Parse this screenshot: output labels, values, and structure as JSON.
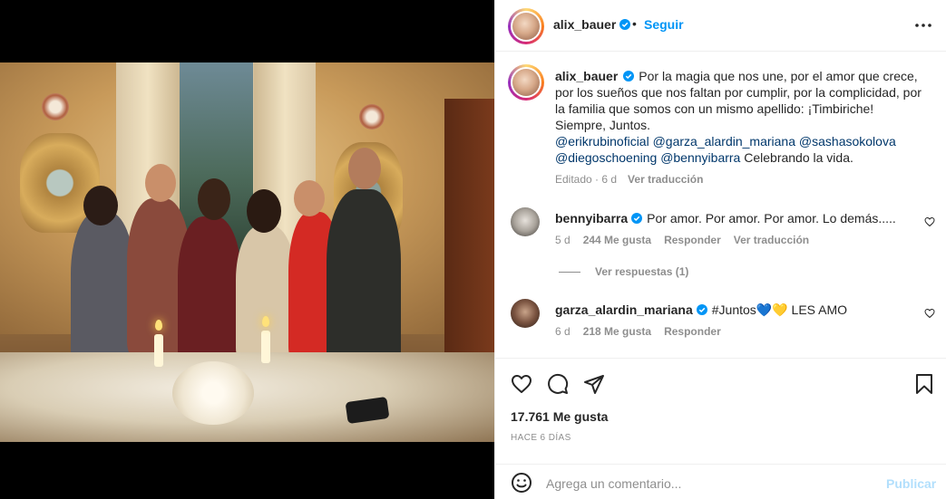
{
  "post": {
    "author": "alix_bauer",
    "follow_label": "Seguir",
    "dot": "•",
    "more_icon": "more-horizontal-icon"
  },
  "caption": {
    "author": "alix_bauer",
    "text": "Por la magia que nos une, por el amor que crece, por los sueños que nos faltan por cumplir, por la complicidad, por la familia que somos con un mismo apellido: ¡Timbiriche! Siempre, Juntos.",
    "tags": [
      "@erikrubinoficial",
      "@garza_alardin_mariana",
      "@sashasokolova",
      "@diegoschoening",
      "@bennyibarra"
    ],
    "tail": "Celebrando la vida.",
    "edited": "Editado · 6 d",
    "translate": "Ver traducción"
  },
  "comments": [
    {
      "author": "bennyibarra",
      "text": "Por amor. Por amor. Por amor. Lo demás.....",
      "time": "5 d",
      "likes": "244 Me gusta",
      "reply": "Responder",
      "translate": "Ver traducción",
      "view_replies": "Ver respuestas (1)"
    },
    {
      "author": "garza_alardin_mariana",
      "text": "#Juntos💙💛 LES AMO",
      "time": "6 d",
      "likes": "218 Me gusta",
      "reply": "Responder"
    }
  ],
  "actions": {
    "like_icon": "heart-icon",
    "comment_icon": "comment-icon",
    "share_icon": "send-icon",
    "save_icon": "bookmark-icon"
  },
  "stats": {
    "likes": "17.761 Me gusta",
    "date": "HACE 6 DÍAS"
  },
  "add_comment": {
    "placeholder": "Agrega un comentario...",
    "publish": "Publicar"
  },
  "colors": {
    "accent": "#0095f6",
    "link": "#00376b",
    "muted": "#8e8e8e",
    "publish_disabled": "#b2dffc"
  }
}
